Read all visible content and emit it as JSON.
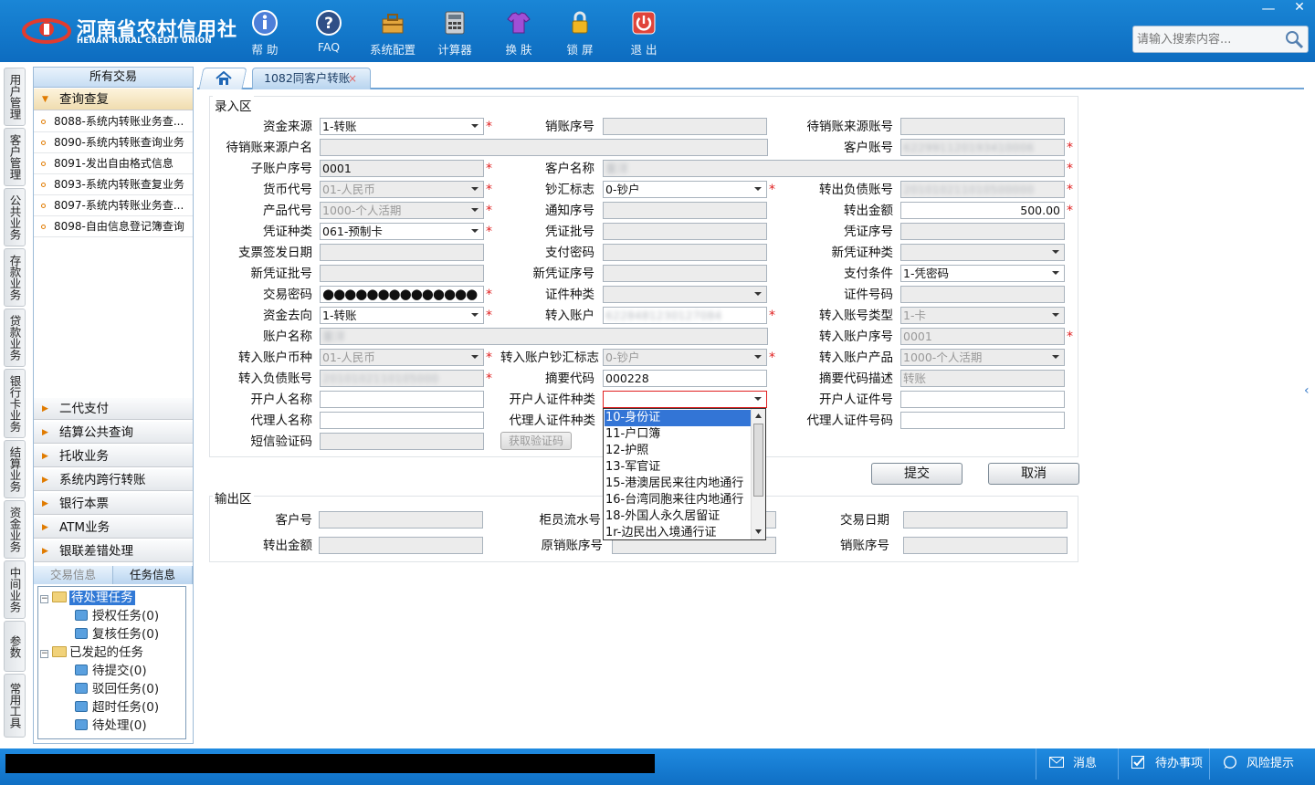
{
  "header": {
    "logo_cn": "河南省农村信用社",
    "logo_en": "HENAN RURAL CREDIT UNION",
    "toolbar": [
      {
        "label": "帮 助",
        "icon": "info-icon"
      },
      {
        "label": "FAQ",
        "icon": "question-icon"
      },
      {
        "label": "系统配置",
        "icon": "toolbox-icon"
      },
      {
        "label": "计算器",
        "icon": "calculator-icon"
      },
      {
        "label": "换 肤",
        "icon": "shirt-icon"
      },
      {
        "label": "锁 屏",
        "icon": "lock-icon"
      },
      {
        "label": "退 出",
        "icon": "power-icon"
      }
    ],
    "search_placeholder": "请输入搜索内容..."
  },
  "vertical_tabs": [
    "用户管理",
    "客户管理",
    "公共业务",
    "存款业务",
    "贷款业务",
    "银行卡业务",
    "结算业务",
    "资金业务",
    "中间业务",
    "参数",
    "常用工具"
  ],
  "menu": {
    "header": "所有交易",
    "query_category": "查询查复",
    "query_items": [
      "8088-系统内转账业务查...",
      "8090-系统内转账查询业务",
      "8091-发出自由格式信息",
      "8093-系统内转账查复业务",
      "8097-系统内转账业务查...",
      "8098-自由信息登记簿查询"
    ],
    "categories": [
      "二代支付",
      "结算公共查询",
      "托收业务",
      "系统内跨行转账",
      "银行本票",
      "ATM业务",
      "银联差错处理"
    ],
    "info_tabs": [
      "交易信息",
      "任务信息"
    ],
    "tree": {
      "pending": "待处理任务",
      "auth": "授权任务(0)",
      "review": "复核任务(0)",
      "initiated": "已发起的任务",
      "to_submit": "待提交(0)",
      "rejected": "驳回任务(0)",
      "timeout": "超时任务(0)",
      "to_process": "待处理(0)"
    }
  },
  "tabs": {
    "active": "1082同客户转账",
    "close": "×"
  },
  "form": {
    "input_section": "录入区",
    "output_section": "输出区",
    "labels": {
      "fund_source": "资金来源",
      "writeoff_seq": "销账序号",
      "pending_src_acct": "待销账来源账号",
      "pending_src_name": "待销账来源户名",
      "cust_acct": "客户账号",
      "sub_acct_seq": "子账户序号",
      "cust_name": "客户名称",
      "currency": "货币代号",
      "cash_flag": "钞汇标志",
      "out_liab_acct": "转出负债账号",
      "product": "产品代号",
      "notice_seq": "通知序号",
      "out_amount": "转出金额",
      "voucher_type": "凭证种类",
      "voucher_batch": "凭证批号",
      "voucher_seq": "凭证序号",
      "check_date": "支票签发日期",
      "pay_pwd": "支付密码",
      "new_voucher_type": "新凭证种类",
      "new_voucher_batch": "新凭证批号",
      "new_voucher_seq": "新凭证序号",
      "pay_cond": "支付条件",
      "txn_pwd": "交易密码",
      "id_type": "证件种类",
      "id_no": "证件号码",
      "fund_dest": "资金去向",
      "in_acct": "转入账户",
      "in_acct_type": "转入账号类型",
      "acct_name": "账户名称",
      "in_acct_seq": "转入账户序号",
      "in_currency": "转入账户币种",
      "in_cash_flag": "转入账户钞汇标志",
      "in_product": "转入账户产品",
      "in_liab_acct": "转入负债账号",
      "summary_code": "摘要代码",
      "summary_desc": "摘要代码描述",
      "opener_name": "开户人名称",
      "opener_id_type": "开户人证件种类",
      "opener_id_no": "开户人证件号",
      "agent_name": "代理人名称",
      "agent_id_type": "代理人证件种类",
      "agent_id_no": "代理人证件号码",
      "sms_code": "短信验证码",
      "out_cust_no": "客户号",
      "teller_flow": "柜员流水号",
      "txn_date": "交易日期",
      "out_out_amount": "转出金额",
      "orig_writeoff_seq": "原销账序号",
      "out_writeoff_seq": "销账序号"
    },
    "values": {
      "fund_source": "1-转账",
      "cust_acct": "622991120193410006",
      "sub_acct_seq": "0001",
      "cust_name": "董洋",
      "currency": "01-人民币",
      "cash_flag": "0-钞户",
      "out_liab_acct": "201010211010500000",
      "product": "1000-个人活期",
      "out_amount": "500.00",
      "voucher_type": "061-预制卡",
      "pay_cond": "1-凭密码",
      "txn_pwd": "●●●●●●●●●●●●●●",
      "fund_dest": "1-转账",
      "in_acct": "6228481230127084",
      "in_acct_type": "1-卡",
      "acct_name": "董洋",
      "in_acct_seq": "0001",
      "in_currency": "01-人民币",
      "in_cash_flag": "0-钞户",
      "in_product": "1000-个人活期",
      "in_liab_acct": "2010102110105000",
      "summary_code": "000228",
      "summary_desc": "转账"
    },
    "get_code": "获取验证码",
    "submit": "提交",
    "cancel": "取消",
    "required_mark": "*"
  },
  "id_type_options": [
    "10-身份证",
    "11-户口簿",
    "12-护照",
    "13-军官证",
    "15-港澳居民来往内地通行",
    "16-台湾同胞来往内地通行",
    "18-外国人永久居留证",
    "1r-边民出入境通行证"
  ],
  "status_bar": {
    "messages": "消息",
    "todo": "待办事项",
    "risk": "风险提示"
  },
  "colors": {
    "header_blue": "#1a86d6",
    "required_red": "#e02020",
    "selection_blue": "#3375d6"
  }
}
